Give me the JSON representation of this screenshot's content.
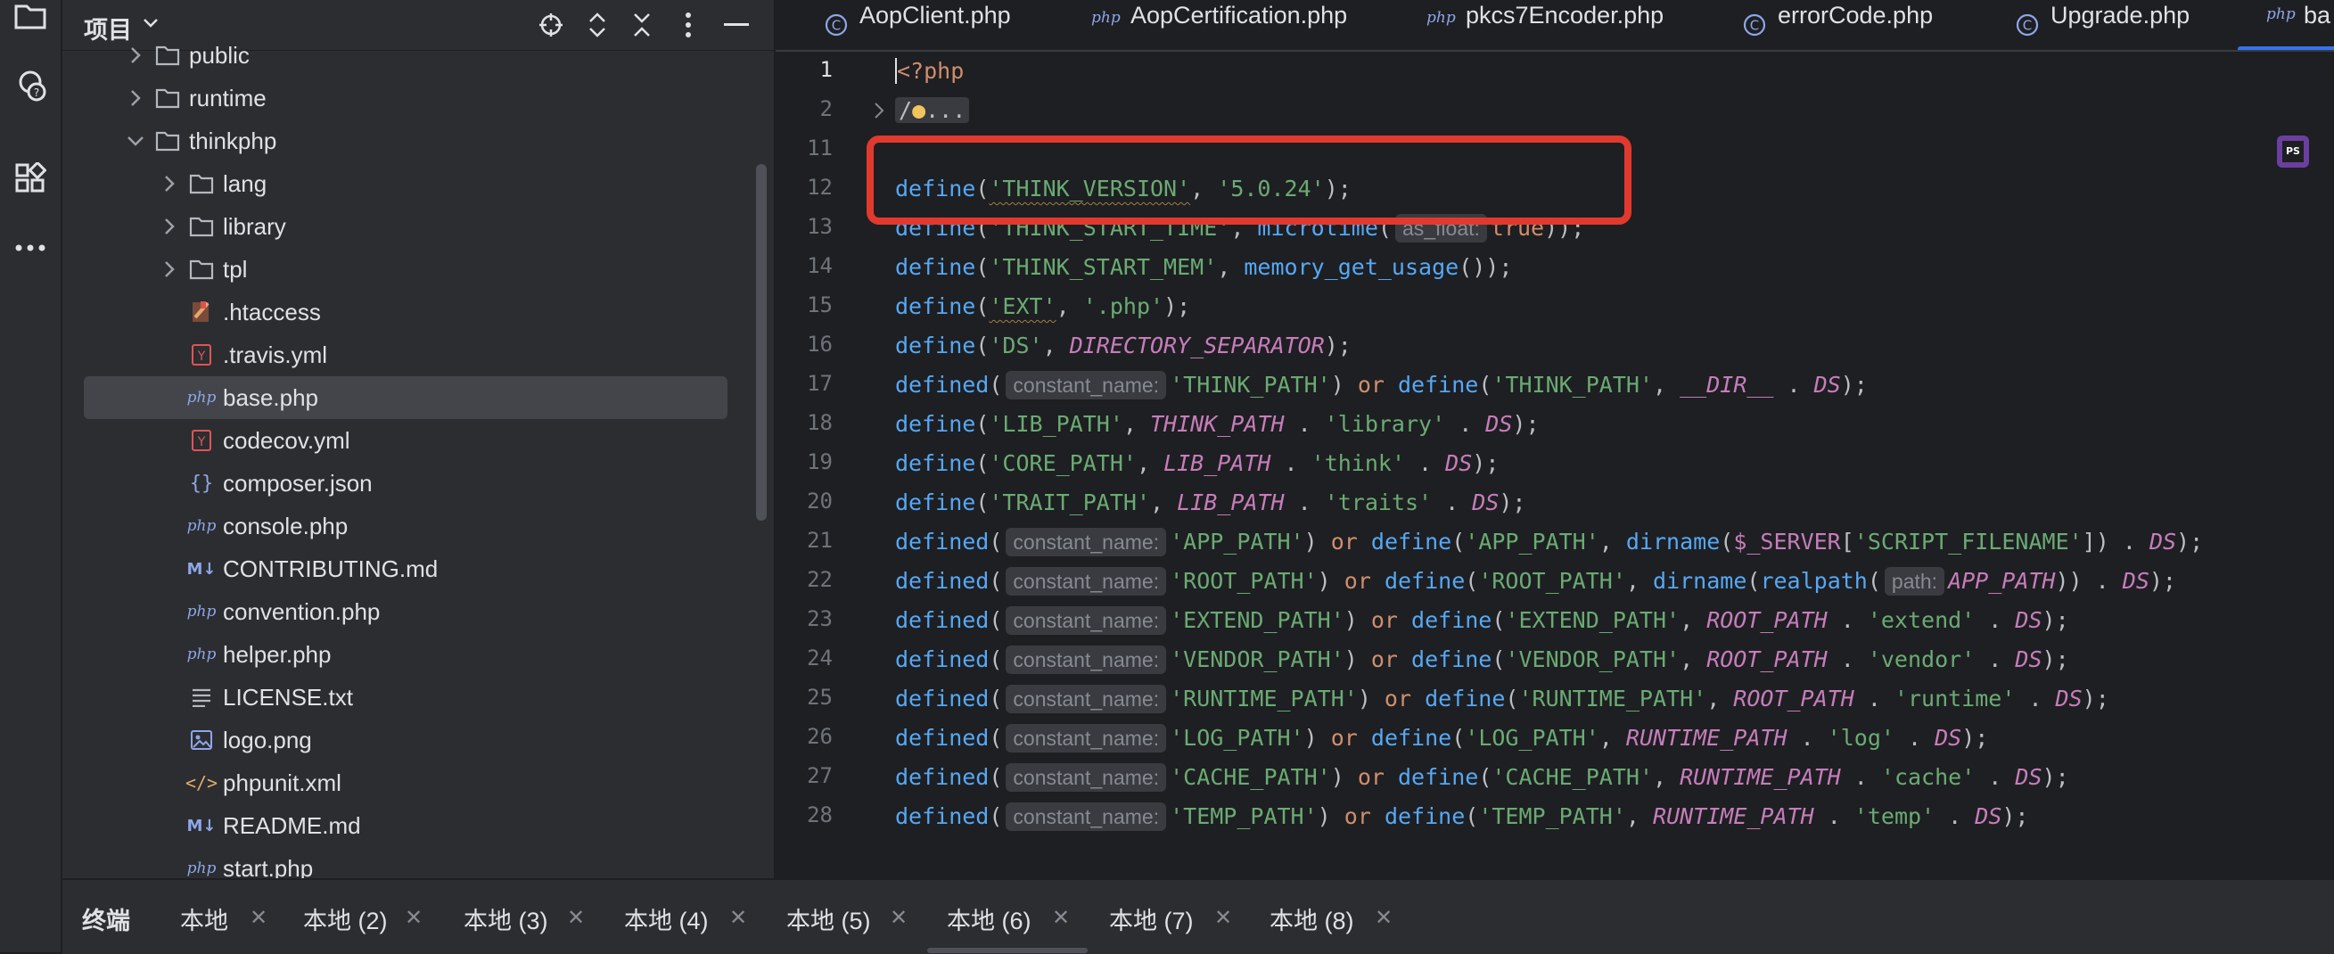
{
  "project": {
    "title": "项目",
    "tree": [
      {
        "label": "public",
        "type": "folder",
        "expanded": false,
        "depth": 1
      },
      {
        "label": "runtime",
        "type": "folder",
        "expanded": false,
        "depth": 1
      },
      {
        "label": "thinkphp",
        "type": "folder",
        "expanded": true,
        "depth": 1
      },
      {
        "label": "lang",
        "type": "folder",
        "expanded": false,
        "depth": 2
      },
      {
        "label": "library",
        "type": "folder",
        "expanded": false,
        "depth": 2
      },
      {
        "label": "tpl",
        "type": "folder",
        "expanded": false,
        "depth": 2
      },
      {
        "label": ".htaccess",
        "type": "htaccess",
        "depth": 2
      },
      {
        "label": ".travis.yml",
        "type": "yml",
        "depth": 2
      },
      {
        "label": "base.php",
        "type": "php",
        "depth": 2,
        "selected": true
      },
      {
        "label": "codecov.yml",
        "type": "yml",
        "depth": 2
      },
      {
        "label": "composer.json",
        "type": "json",
        "depth": 2
      },
      {
        "label": "console.php",
        "type": "php",
        "depth": 2
      },
      {
        "label": "CONTRIBUTING.md",
        "type": "md",
        "depth": 2
      },
      {
        "label": "convention.php",
        "type": "php",
        "depth": 2
      },
      {
        "label": "helper.php",
        "type": "php",
        "depth": 2
      },
      {
        "label": "LICENSE.txt",
        "type": "txt",
        "depth": 2
      },
      {
        "label": "logo.png",
        "type": "png",
        "depth": 2
      },
      {
        "label": "phpunit.xml",
        "type": "xml",
        "depth": 2
      },
      {
        "label": "README.md",
        "type": "md",
        "depth": 2
      },
      {
        "label": "start.php",
        "type": "php",
        "depth": 2
      }
    ]
  },
  "editor": {
    "tabs": [
      {
        "label": "AopClient.php",
        "icon": "class-icon"
      },
      {
        "label": "AopCertification.php",
        "icon": "php-icon"
      },
      {
        "label": "pkcs7Encoder.php",
        "icon": "php-icon"
      },
      {
        "label": "errorCode.php",
        "icon": "class-icon"
      },
      {
        "label": "Upgrade.php",
        "icon": "class-icon"
      },
      {
        "label": "ba",
        "icon": "php-icon",
        "active": true
      }
    ],
    "line_numbers": [
      "1",
      "2",
      "11",
      "12",
      "13",
      "14",
      "15",
      "16",
      "17",
      "18",
      "19",
      "20",
      "21",
      "22",
      "23",
      "24",
      "25",
      "26",
      "27",
      "28"
    ]
  },
  "terminal": {
    "title": "终端",
    "tabs": [
      "本地",
      "本地 (2)",
      "本地 (3)",
      "本地 (4)",
      "本地 (5)",
      "本地 (6)",
      "本地 (7)",
      "本地 (8)"
    ],
    "active_tab": 5
  },
  "colors": {
    "highlight_box": "#e2392e",
    "accent": "#3574f0"
  }
}
